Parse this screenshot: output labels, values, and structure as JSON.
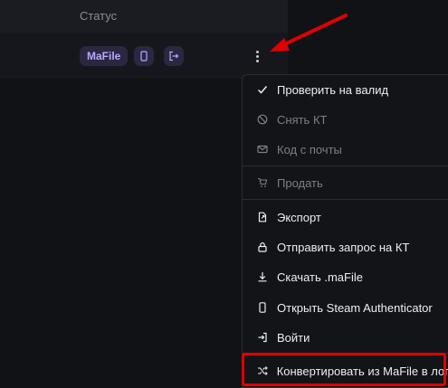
{
  "table": {
    "header": {
      "status_label": "Статус"
    },
    "row": {
      "badge": "MaFile"
    }
  },
  "menu": {
    "items": [
      {
        "label": "Проверить на валид",
        "icon": "check-icon",
        "enabled": true
      },
      {
        "label": "Снять КТ",
        "icon": "ban-icon",
        "enabled": false
      },
      {
        "label": "Код с почты",
        "icon": "mail-icon",
        "enabled": false
      },
      {
        "label": "Продать",
        "icon": "cart-icon",
        "enabled": false
      },
      {
        "label": "Экспорт",
        "icon": "export-icon",
        "enabled": true
      },
      {
        "label": "Отправить запрос на КТ",
        "icon": "lock-icon",
        "enabled": true
      },
      {
        "label": "Скачать .maFile",
        "icon": "download-icon",
        "enabled": true
      },
      {
        "label": "Открыть Steam Authenticator",
        "icon": "phone-icon",
        "enabled": true
      },
      {
        "label": "Войти",
        "icon": "login-icon",
        "enabled": true
      },
      {
        "label": "Конвертировать из MaFile в лог",
        "icon": "shuffle-icon",
        "enabled": true
      }
    ]
  },
  "colors": {
    "annotation": "#e00000",
    "badge_text": "#b9a8ff",
    "badge_bg": "#2a2740"
  }
}
